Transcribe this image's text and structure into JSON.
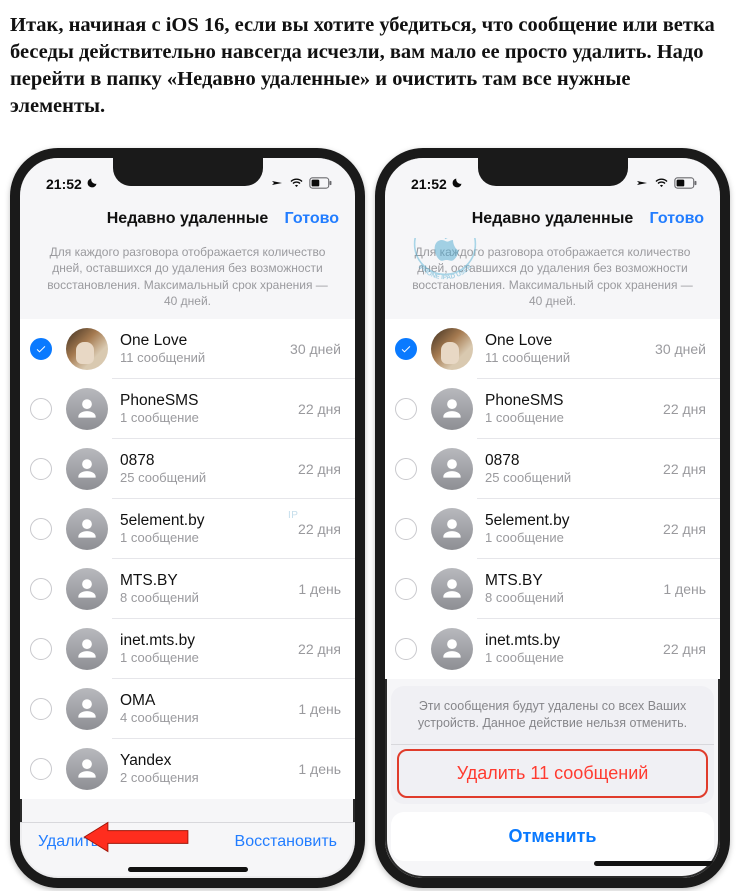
{
  "article": {
    "paragraph": "Итак, начиная с iOS 16, если вы хотите убедиться, что сообщение или ветка беседы действительно навсегда исчезли, вам мало ее просто удалить. Надо перейти в папку «Недавно удаленные» и очистить там все нужные элементы."
  },
  "status": {
    "time": "21:52"
  },
  "nav": {
    "title": "Недавно удаленные",
    "done": "Готово"
  },
  "description": "Для каждого разговора отображается количество дней, оставшихся до удаления без возможности восстановления. Максимальный срок хранения — 40 дней.",
  "items": [
    {
      "name": "One Love",
      "sub": "11 сообщений",
      "days": "30 дней",
      "checked": true,
      "photo": true
    },
    {
      "name": "PhoneSMS",
      "sub": "1 сообщение",
      "days": "22 дня",
      "checked": false,
      "photo": false
    },
    {
      "name": "0878",
      "sub": "25 сообщений",
      "days": "22 дня",
      "checked": false,
      "photo": false
    },
    {
      "name": "5element.by",
      "sub": "1 сообщение",
      "days": "22 дня",
      "checked": false,
      "photo": false
    },
    {
      "name": "MTS.BY",
      "sub": "8 сообщений",
      "days": "1 день",
      "checked": false,
      "photo": false
    },
    {
      "name": "inet.mts.by",
      "sub": "1 сообщение",
      "days": "22 дня",
      "checked": false,
      "photo": false
    },
    {
      "name": "OMA",
      "sub": "4 сообщения",
      "days": "1 день",
      "checked": false,
      "photo": false
    },
    {
      "name": "Yandex",
      "sub": "2 сообщения",
      "days": "1 день",
      "checked": false,
      "photo": false
    }
  ],
  "toolbar": {
    "delete": "Удалить",
    "restore": "Восстановить"
  },
  "sheet": {
    "message": "Эти сообщения будут удалены со всех Ваших устройств. Данное действие нельзя отменить.",
    "delete_n": "Удалить 11 сообщений",
    "cancel": "Отменить"
  },
  "watermark": {
    "ring": "MADE FOR · IPHONE IPAD USER ·"
  }
}
